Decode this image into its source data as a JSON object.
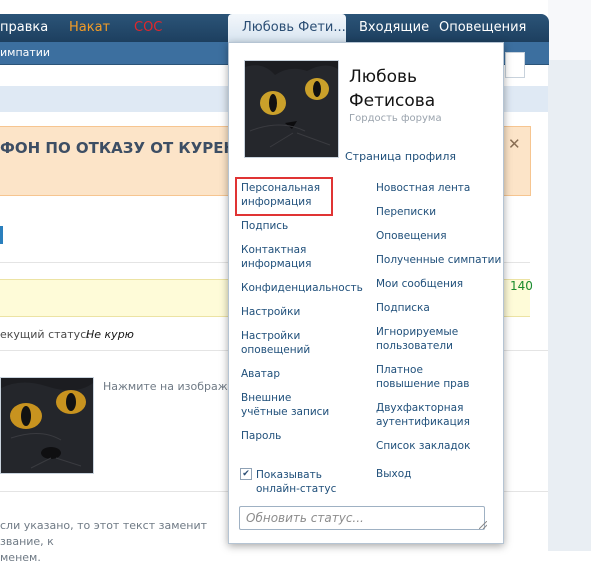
{
  "topnav": {
    "items": [
      "правка",
      "Накат",
      "СОС",
      "Входящие",
      "Оповещения"
    ],
    "active_tab": "Любовь Фети..."
  },
  "subnav": {
    "label": "импатии"
  },
  "notice": {
    "text": "ФОН ПО ОТКАЗУ ОТ КУРЕНИЯ",
    "close_symbol": "✕"
  },
  "stats": {
    "count": "140"
  },
  "status_line": {
    "label": "екущий статус:",
    "value": "Не курю"
  },
  "avatar_hint": "Нажмите на изображени",
  "info_text": "сли указано, то этот текст заменит звание, к\nменем.",
  "user_menu": {
    "name": "Любовь Фетисова",
    "title": "Гордость форума",
    "profile_link": "Страница профиля",
    "left_items": [
      "Персональная информация",
      "Подпись",
      "Контактная информация",
      "Конфиденциальность",
      "Настройки",
      "Настройки оповещений",
      "Аватар",
      "Внешние учётные записи",
      "Пароль"
    ],
    "right_items": [
      "Новостная лента",
      "Переписки",
      "Оповещения",
      "Полученные симпатии",
      "Мои сообщения",
      "Подписка",
      "Игнорируемые пользователи",
      "Платное повышение прав",
      "Двухфакторная аутентификация",
      "Список закладок",
      "Выход"
    ],
    "online_status_checkbox": {
      "label": "Показывать онлайн-статус",
      "checked": true
    },
    "status_input_placeholder": "Обновить статус..."
  },
  "colors": {
    "nav_bg": "#1d3f5f",
    "link": "#1f4f7a",
    "notice_bg": "#fce4c8",
    "highlight_border": "#e03434"
  }
}
